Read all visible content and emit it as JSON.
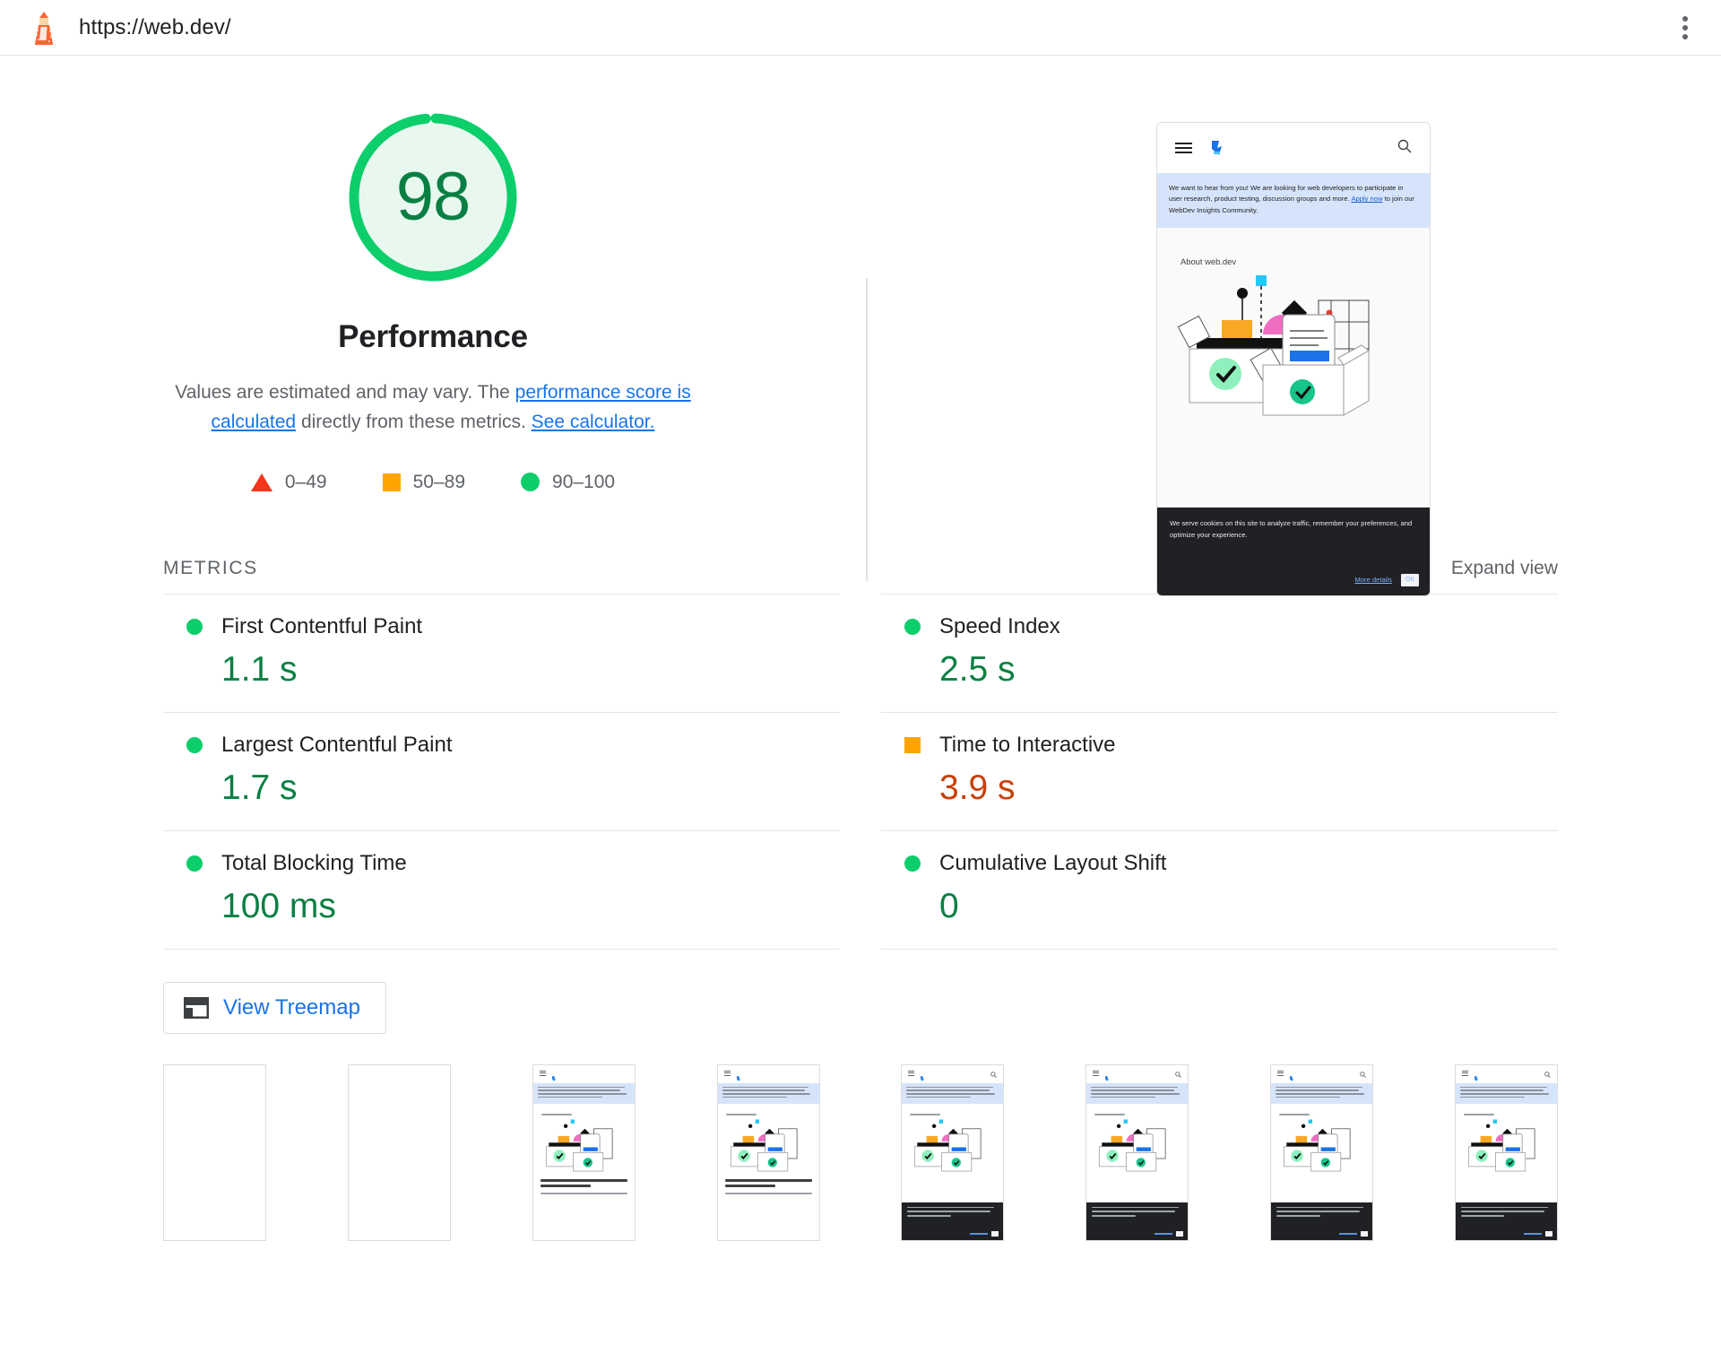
{
  "topbar": {
    "logo_icon": "lighthouse-icon",
    "url": "https://web.dev/",
    "menu_icon": "kebab-menu-icon"
  },
  "score": {
    "value": "98",
    "value_number": 98,
    "category": "Performance",
    "ring_color": "#0cce6b",
    "fill_color": "#e8f8ef",
    "text_color": "#0a7f43"
  },
  "description": {
    "part1": "Values are estimated and may vary. The ",
    "link1": "performance score is calculated",
    "part2": " directly from these metrics. ",
    "link2": "See calculator."
  },
  "legend": {
    "items": [
      {
        "icon": "fail-triangle-icon",
        "label": "0–49",
        "color": "#f4361c"
      },
      {
        "icon": "average-square-icon",
        "label": "50–89",
        "color": "#ffa400"
      },
      {
        "icon": "pass-circle-icon",
        "label": "90–100",
        "color": "#0cce6b"
      }
    ]
  },
  "screenshot": {
    "hamburger_icon": "hamburger-menu-icon",
    "logo_icon": "webdev-logo-icon",
    "search_icon": "search-icon",
    "banner_text": "We want to hear from you! We are looking for web developers to participate in user research, product testing, discussion groups and more. Apply now to join our WebDev Insights Community.",
    "banner_link": "Apply now",
    "banner_before": "We want to hear from you! We are looking for web developers to participate in user research, product testing, discussion groups and more. ",
    "banner_after": " to join our WebDev Insights Community.",
    "section_heading": "About web.dev",
    "cookie_text": "We serve cookies on this site to analyze traffic, remember your preferences, and optimize your experience.",
    "cookie_link": "More details",
    "cookie_button": "OK"
  },
  "metrics_section": {
    "title": "METRICS",
    "expand_view": "Expand view",
    "items": [
      {
        "name": "First Contentful Paint",
        "value": "1.1 s",
        "rating": "pass"
      },
      {
        "name": "Speed Index",
        "value": "2.5 s",
        "rating": "pass"
      },
      {
        "name": "Largest Contentful Paint",
        "value": "1.7 s",
        "rating": "pass"
      },
      {
        "name": "Time to Interactive",
        "value": "3.9 s",
        "rating": "avg"
      },
      {
        "name": "Total Blocking Time",
        "value": "100 ms",
        "rating": "pass"
      },
      {
        "name": "Cumulative Layout Shift",
        "value": "0",
        "rating": "pass"
      }
    ]
  },
  "treemap": {
    "icon": "treemap-icon",
    "label": "View Treemap"
  },
  "filmstrip": {
    "frames": [
      {
        "state": "blank"
      },
      {
        "state": "blank"
      },
      {
        "state": "content"
      },
      {
        "state": "content"
      },
      {
        "state": "cookie"
      },
      {
        "state": "cookie"
      },
      {
        "state": "cookie"
      },
      {
        "state": "cookie"
      },
      {
        "state": "cookie"
      }
    ]
  }
}
